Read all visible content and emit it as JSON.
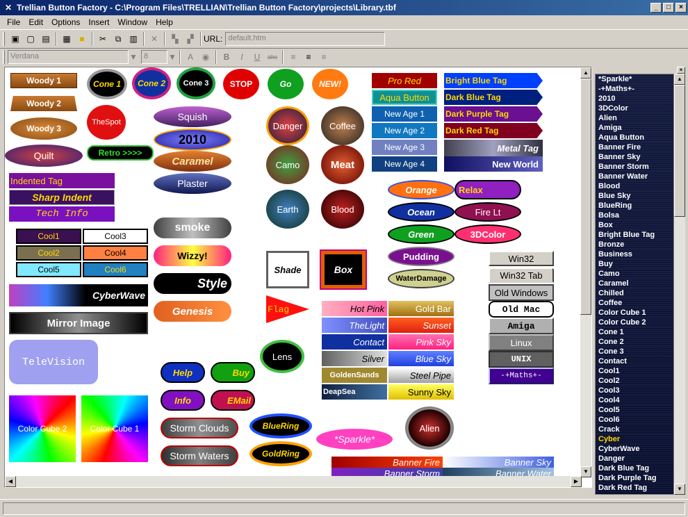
{
  "window": {
    "title": "Trellian Button Factory - C:\\Program Files\\TRELLIAN\\Trellian Button Factory\\projects\\Library.tbf"
  },
  "menu": [
    "File",
    "Edit",
    "Options",
    "Insert",
    "Window",
    "Help"
  ],
  "toolbar": {
    "url_label": "URL:",
    "url_value": "default.htm",
    "font_value": "Verdana",
    "size_value": "8",
    "bold": "B",
    "italic": "I",
    "underline": "U",
    "strike": "abc",
    "font_a": "A"
  },
  "buttons": [
    {
      "label": "Woody 1"
    },
    {
      "label": "Woody 2"
    },
    {
      "label": "Woody 3"
    },
    {
      "label": "Quilt"
    },
    {
      "label": "Cone 1"
    },
    {
      "label": "Cone 2"
    },
    {
      "label": "Cone 3"
    },
    {
      "label": "STOP"
    },
    {
      "label": "Go"
    },
    {
      "label": "NEW!"
    },
    {
      "label": "TheSpot"
    },
    {
      "label": "Retro >>>>"
    },
    {
      "label": "Squish"
    },
    {
      "label": "2010"
    },
    {
      "label": "Caramel"
    },
    {
      "label": "Plaster"
    },
    {
      "label": "Danger"
    },
    {
      "label": "Coffee"
    },
    {
      "label": "Camo"
    },
    {
      "label": "Meat"
    },
    {
      "label": "Earth"
    },
    {
      "label": "Blood"
    },
    {
      "label": "Pro Red"
    },
    {
      "label": "Aqua Button"
    },
    {
      "label": "New Age 1"
    },
    {
      "label": "New Age 2"
    },
    {
      "label": "New Age 3"
    },
    {
      "label": "New Age 4"
    },
    {
      "label": "Bright Blue Tag"
    },
    {
      "label": "Dark Blue Tag"
    },
    {
      "label": "Dark Purple Tag"
    },
    {
      "label": "Dark Red Tag"
    },
    {
      "label": "Metal Tag"
    },
    {
      "label": "New World"
    },
    {
      "label": "Indented Tag"
    },
    {
      "label": "Sharp Indent"
    },
    {
      "label": "Tech Info"
    },
    {
      "label": "Cool1"
    },
    {
      "label": "Cool3"
    },
    {
      "label": "Cool2"
    },
    {
      "label": "Cool4"
    },
    {
      "label": "Cool5"
    },
    {
      "label": "Cool6"
    },
    {
      "label": "smoke"
    },
    {
      "label": "Wizzy!"
    },
    {
      "label": "Style"
    },
    {
      "label": "Genesis"
    },
    {
      "label": "CyberWave"
    },
    {
      "label": "Mirror Image"
    },
    {
      "label": "TeleVision"
    },
    {
      "label": "Shade"
    },
    {
      "label": "Box"
    },
    {
      "label": "Flag"
    },
    {
      "label": "Lens"
    },
    {
      "label": "Orange"
    },
    {
      "label": "Relax"
    },
    {
      "label": "Ocean"
    },
    {
      "label": "Fire Lt"
    },
    {
      "label": "Green"
    },
    {
      "label": "3DColor"
    },
    {
      "label": "Pudding"
    },
    {
      "label": "WaterDamage"
    },
    {
      "label": "Hot Pink"
    },
    {
      "label": "Gold Bar"
    },
    {
      "label": "TheLight"
    },
    {
      "label": "Sunset"
    },
    {
      "label": "Contact"
    },
    {
      "label": "Pink Sky"
    },
    {
      "label": "Silver"
    },
    {
      "label": "Blue Sky"
    },
    {
      "label": "GoldenSands"
    },
    {
      "label": "Steel Pipe"
    },
    {
      "label": "DeapSea"
    },
    {
      "label": "Sunny Sky"
    },
    {
      "label": "Win32"
    },
    {
      "label": "Win32 Tab"
    },
    {
      "label": "Old Windows"
    },
    {
      "label": "Old Mac"
    },
    {
      "label": "Amiga"
    },
    {
      "label": "Linux"
    },
    {
      "label": "UNIX"
    },
    {
      "label": "-+Maths+-"
    },
    {
      "label": "Help"
    },
    {
      "label": "Buy"
    },
    {
      "label": "Info"
    },
    {
      "label": "EMail"
    },
    {
      "label": "Storm Clouds"
    },
    {
      "label": "Storm Waters"
    },
    {
      "label": "BlueRing"
    },
    {
      "label": "GoldRing"
    },
    {
      "label": "*Sparkle*"
    },
    {
      "label": "Alien"
    },
    {
      "label": "Color Cube 2"
    },
    {
      "label": "Color Cube 1"
    },
    {
      "label": "Banner Fire"
    },
    {
      "label": "Banner Sky"
    },
    {
      "label": "Banner Storm"
    },
    {
      "label": "Banner Water"
    }
  ],
  "side_list": {
    "items": [
      "*Sparkle*",
      "-+Maths+-",
      "2010",
      "3DColor",
      "Alien",
      "Amiga",
      "Aqua Button",
      "Banner Fire",
      "Banner Sky",
      "Banner Storm",
      "Banner Water",
      "Blood",
      "Blue Sky",
      "BlueRing",
      "Bolsa",
      "Box",
      "Bright Blue Tag",
      "Bronze",
      "Business",
      "Buy",
      "Camo",
      "Caramel",
      "Chilled",
      "Coffee",
      "Color Cube 1",
      "Color Cube 2",
      "Cone 1",
      "Cone 2",
      "Cone 3",
      "Contact",
      "Cool1",
      "Cool2",
      "Cool3",
      "Cool4",
      "Cool5",
      "Cool6",
      "Crack",
      "Cyber",
      "CyberWave",
      "Danger",
      "Dark Blue Tag",
      "Dark Purple Tag",
      "Dark Red Tag"
    ],
    "selected": "Cyber"
  }
}
